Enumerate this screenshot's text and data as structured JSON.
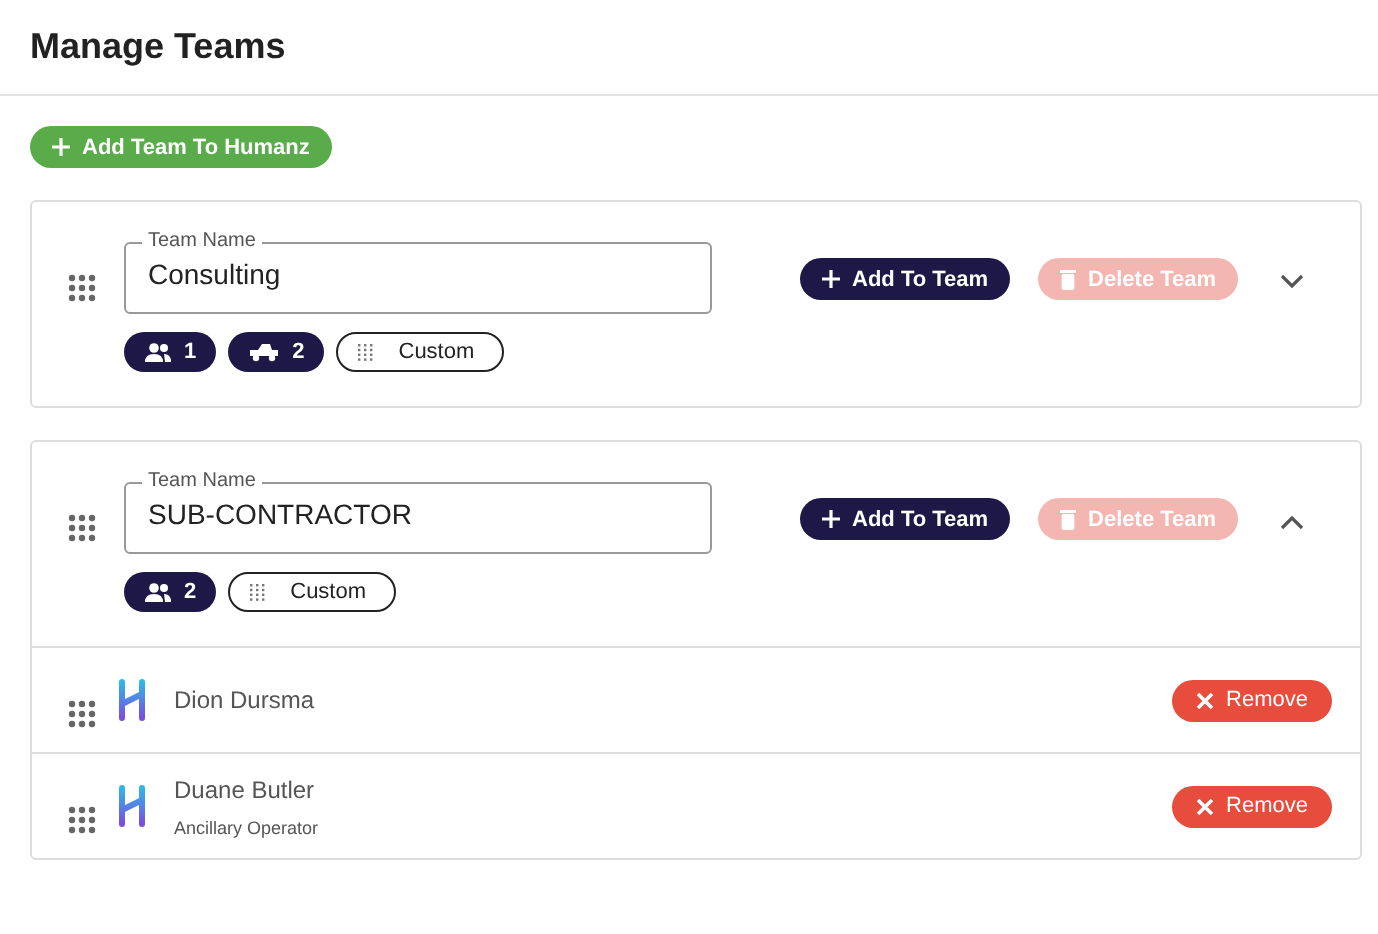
{
  "title": "Manage Teams",
  "add_team_button": "Add Team To Humanz",
  "teams": [
    {
      "field_label": "Team Name",
      "name": "Consulting",
      "add_button": "Add To Team",
      "delete_button": "Delete Team",
      "delete_disabled": true,
      "expanded": false,
      "chips": [
        {
          "kind": "people",
          "label": "1"
        },
        {
          "kind": "vehicle",
          "label": "2"
        },
        {
          "kind": "custom",
          "label": "Custom"
        }
      ]
    },
    {
      "field_label": "Team Name",
      "name": "SUB-CONTRACTOR",
      "add_button": "Add To Team",
      "delete_button": "Delete Team",
      "delete_disabled": true,
      "expanded": true,
      "chips": [
        {
          "kind": "people",
          "label": "2"
        },
        {
          "kind": "custom",
          "label": "Custom"
        }
      ],
      "members": [
        {
          "name": "Dion Dursma",
          "remove_button": "Remove"
        },
        {
          "name": "Duane Butler",
          "role": "Ancillary Operator",
          "remove_button": "Remove"
        }
      ]
    }
  ]
}
